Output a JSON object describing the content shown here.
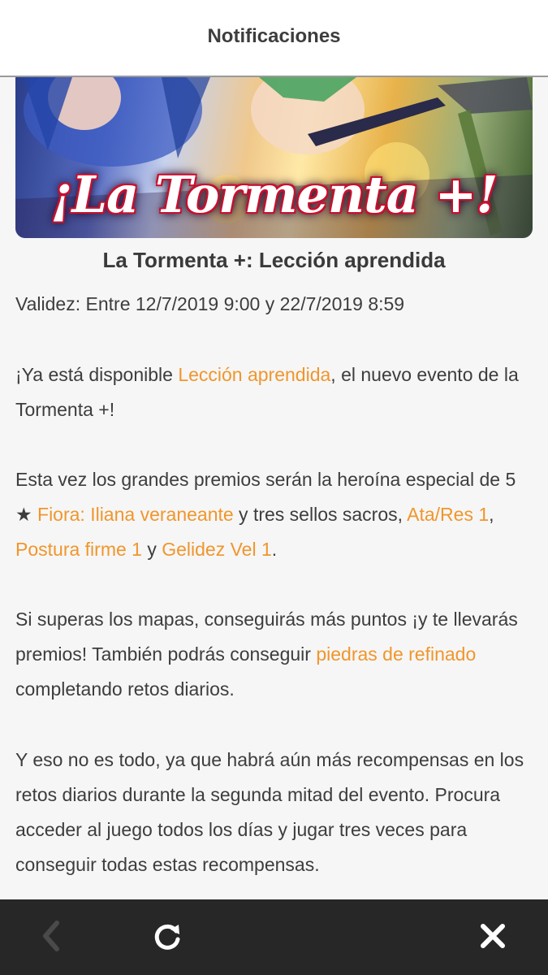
{
  "header": {
    "title": "Notificaciones"
  },
  "banner": {
    "logo_text": "¡La Tormenta +!"
  },
  "article": {
    "title": "La Tormenta +: Lección aprendida",
    "validity": "Validez: Entre 12/7/2019 9:00 y 22/7/2019 8:59",
    "p1": {
      "t1": "¡Ya está disponible ",
      "link1": "Lección aprendida",
      "t2": ", el nuevo evento de la Tormenta +!"
    },
    "p2": {
      "t1": "Esta vez los grandes premios serán la heroína especial de 5 ★ ",
      "link1": "Fiora: Iliana veraneante",
      "t2": " y tres sellos sacros, ",
      "link2": "Ata/Res 1",
      "t3": ", ",
      "link3": "Postura firme 1",
      "t4": " y ",
      "link4": "Gelidez Vel 1",
      "t5": "."
    },
    "p3": {
      "t1": "Si superas los mapas, conseguirás más puntos ¡y te llevarás premios! También podrás conseguir ",
      "link1": "piedras de refinado",
      "t2": " completando retos diarios."
    },
    "p4": {
      "t1": "Y eso no es todo, ya que habrá aún más recompensas en los retos diarios durante la segunda mitad del evento. Procura acceder al juego todos los días y jugar tres veces para conseguir todas estas recompensas."
    }
  },
  "colors": {
    "link": "#f0962c",
    "bottom_bar": "#272727",
    "background": "#f6f6f6"
  },
  "bottom_nav": {
    "back_icon": "chevron-left-icon",
    "reload_icon": "reload-icon",
    "close_icon": "close-icon"
  }
}
